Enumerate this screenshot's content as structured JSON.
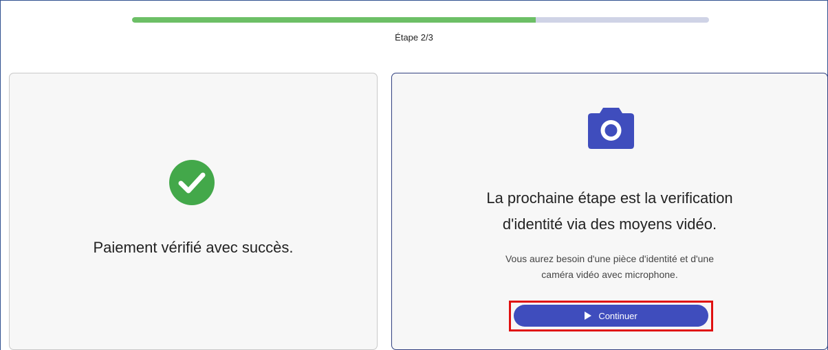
{
  "progress": {
    "fraction": 0.7,
    "step_label": "Étape 2/3",
    "fill_color": "#6cbf66",
    "track_color": "#cfd3e6"
  },
  "payment_card": {
    "icon": "check-circle-icon",
    "icon_color": "#43a84a",
    "message": "Paiement vérifié avec succès."
  },
  "identity_card": {
    "icon": "camera-icon",
    "icon_color": "#3f4dbd",
    "title_line1": "La prochaine étape est la verification",
    "title_line2": "d'identité via des moyens vidéo.",
    "sub_line1": "Vous aurez besoin d'une pièce d'identité et d'une",
    "sub_line2": "caméra vidéo avec microphone.",
    "button_icon": "play-icon",
    "button_label": "Continuer",
    "button_color": "#3f4dbd",
    "highlight_color": "#e01010"
  }
}
